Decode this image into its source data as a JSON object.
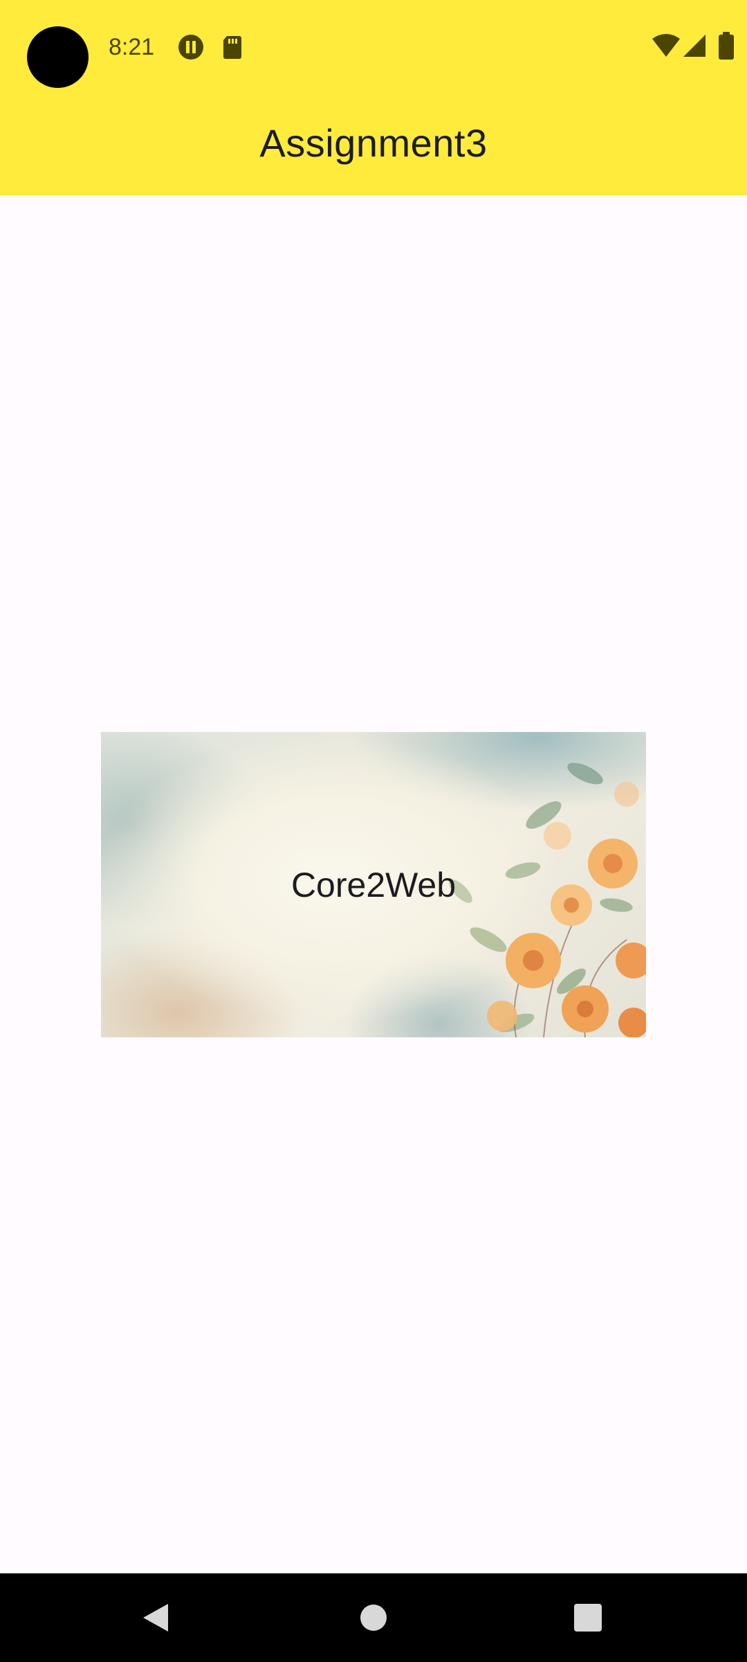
{
  "status_bar": {
    "time": "8:21",
    "left_icons": [
      "pause-circle-icon",
      "sd-card-icon"
    ],
    "right_icons": [
      "wifi-icon",
      "cellular-signal-icon",
      "battery-icon"
    ]
  },
  "app_bar": {
    "title": "Assignment3",
    "background": "#ffeb3b"
  },
  "main": {
    "card": {
      "image": "floral-watercolor-background",
      "text": "Core2Web"
    }
  },
  "navigation": {
    "buttons": [
      "back-icon",
      "home-icon",
      "recents-icon"
    ]
  },
  "colors": {
    "accent": "#ffeb3b",
    "status_icon": "#4b4500",
    "text": "#1c1b1f",
    "background": "#fffbfe",
    "nav_background": "#000000"
  }
}
